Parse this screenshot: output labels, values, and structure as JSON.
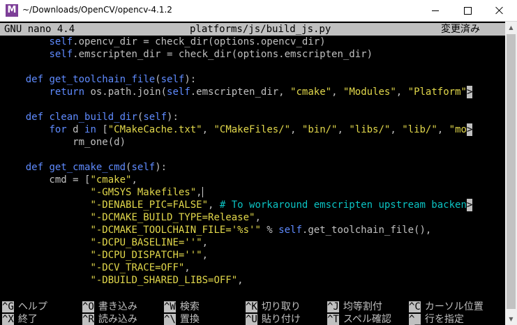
{
  "window": {
    "title": "~/Downloads/OpenCV/opencv-4.1.2",
    "app_icon_letter": "M"
  },
  "nano": {
    "version": "GNU nano 4.4",
    "filename": "platforms/js/build_js.py",
    "status": "変更済み"
  },
  "code_lines": [
    [
      {
        "c": "",
        "t": "        "
      },
      {
        "c": "t-slf",
        "t": "self"
      },
      {
        "c": "",
        "t": ".opencv_dir = check_dir(options.opencv_dir)"
      }
    ],
    [
      {
        "c": "",
        "t": "        "
      },
      {
        "c": "t-slf",
        "t": "self"
      },
      {
        "c": "",
        "t": ".emscripten_dir = check_dir(options.emscripten_dir)"
      }
    ],
    [],
    [
      {
        "c": "",
        "t": "    "
      },
      {
        "c": "t-kw",
        "t": "def"
      },
      {
        "c": "",
        "t": " "
      },
      {
        "c": "t-fn",
        "t": "get_toolchain_file"
      },
      {
        "c": "",
        "t": "("
      },
      {
        "c": "t-slf",
        "t": "self"
      },
      {
        "c": "",
        "t": "):"
      }
    ],
    [
      {
        "c": "",
        "t": "        "
      },
      {
        "c": "t-kw",
        "t": "return"
      },
      {
        "c": "",
        "t": " os.path.join("
      },
      {
        "c": "t-slf",
        "t": "self"
      },
      {
        "c": "",
        "t": ".emscripten_dir, "
      },
      {
        "c": "t-str",
        "t": "\"cmake\""
      },
      {
        "c": "",
        "t": ", "
      },
      {
        "c": "t-str",
        "t": "\"Modules\""
      },
      {
        "c": "",
        "t": ", "
      },
      {
        "c": "t-str",
        "t": "\"Platform\""
      },
      {
        "c": "cont",
        "t": ">"
      }
    ],
    [],
    [
      {
        "c": "",
        "t": "    "
      },
      {
        "c": "t-kw",
        "t": "def"
      },
      {
        "c": "",
        "t": " "
      },
      {
        "c": "t-fn",
        "t": "clean_build_dir"
      },
      {
        "c": "",
        "t": "("
      },
      {
        "c": "t-slf",
        "t": "self"
      },
      {
        "c": "",
        "t": "):"
      }
    ],
    [
      {
        "c": "",
        "t": "        "
      },
      {
        "c": "t-kw",
        "t": "for"
      },
      {
        "c": "",
        "t": " d "
      },
      {
        "c": "t-kw",
        "t": "in"
      },
      {
        "c": "",
        "t": " ["
      },
      {
        "c": "t-str",
        "t": "\"CMakeCache.txt\""
      },
      {
        "c": "",
        "t": ", "
      },
      {
        "c": "t-str",
        "t": "\"CMakeFiles/\""
      },
      {
        "c": "",
        "t": ", "
      },
      {
        "c": "t-str",
        "t": "\"bin/\""
      },
      {
        "c": "",
        "t": ", "
      },
      {
        "c": "t-str",
        "t": "\"libs/\""
      },
      {
        "c": "",
        "t": ", "
      },
      {
        "c": "t-str",
        "t": "\"lib/\""
      },
      {
        "c": "",
        "t": ", "
      },
      {
        "c": "t-str",
        "t": "\"mo"
      },
      {
        "c": "cont",
        "t": ">"
      }
    ],
    [
      {
        "c": "",
        "t": "            rm_one(d)"
      }
    ],
    [],
    [
      {
        "c": "",
        "t": "    "
      },
      {
        "c": "t-kw",
        "t": "def"
      },
      {
        "c": "",
        "t": " "
      },
      {
        "c": "t-fn",
        "t": "get_cmake_cmd"
      },
      {
        "c": "",
        "t": "("
      },
      {
        "c": "t-slf",
        "t": "self"
      },
      {
        "c": "",
        "t": "):"
      }
    ],
    [
      {
        "c": "",
        "t": "        cmd = ["
      },
      {
        "c": "t-str",
        "t": "\"cmake\""
      },
      {
        "c": "",
        "t": ","
      }
    ],
    [
      {
        "c": "",
        "t": "               "
      },
      {
        "c": "t-str",
        "t": "\"-GMSYS Makefiles\""
      },
      {
        "c": "",
        "t": ","
      },
      {
        "c": "cursor",
        "t": ""
      }
    ],
    [
      {
        "c": "",
        "t": "               "
      },
      {
        "c": "t-str",
        "t": "\"-DENABLE_PIC=FALSE\""
      },
      {
        "c": "",
        "t": ", "
      },
      {
        "c": "t-cmt",
        "t": "# To workaround emscripten upstream backen"
      },
      {
        "c": "cont",
        "t": ">"
      }
    ],
    [
      {
        "c": "",
        "t": "               "
      },
      {
        "c": "t-str",
        "t": "\"-DCMAKE_BUILD_TYPE=Release\""
      },
      {
        "c": "",
        "t": ","
      }
    ],
    [
      {
        "c": "",
        "t": "               "
      },
      {
        "c": "t-str",
        "t": "\"-DCMAKE_TOOLCHAIN_FILE='%s'\""
      },
      {
        "c": "",
        "t": " % "
      },
      {
        "c": "t-slf",
        "t": "self"
      },
      {
        "c": "",
        "t": ".get_toolchain_file(),"
      }
    ],
    [
      {
        "c": "",
        "t": "               "
      },
      {
        "c": "t-str",
        "t": "\"-DCPU_BASELINE=''\""
      },
      {
        "c": "",
        "t": ","
      }
    ],
    [
      {
        "c": "",
        "t": "               "
      },
      {
        "c": "t-str",
        "t": "\"-DCPU_DISPATCH=''\""
      },
      {
        "c": "",
        "t": ","
      }
    ],
    [
      {
        "c": "",
        "t": "               "
      },
      {
        "c": "t-str",
        "t": "\"-DCV_TRACE=OFF\""
      },
      {
        "c": "",
        "t": ","
      }
    ],
    [
      {
        "c": "",
        "t": "               "
      },
      {
        "c": "t-str",
        "t": "\"-DBUILD_SHARED_LIBS=OFF\""
      },
      {
        "c": "",
        "t": ","
      }
    ],
    []
  ],
  "shortcuts": [
    [
      {
        "key": "^G",
        "label": "ヘルプ"
      },
      {
        "key": "^O",
        "label": "書き込み"
      },
      {
        "key": "^W",
        "label": "検索"
      },
      {
        "key": "^K",
        "label": "切り取り"
      },
      {
        "key": "^J",
        "label": "均等割付"
      },
      {
        "key": "^C",
        "label": "カーソル位置"
      }
    ],
    [
      {
        "key": "^X",
        "label": "終了"
      },
      {
        "key": "^R",
        "label": "読み込み"
      },
      {
        "key": "^\\",
        "label": "置換"
      },
      {
        "key": "^U",
        "label": "貼り付け"
      },
      {
        "key": "^T",
        "label": "スペル確認"
      },
      {
        "key": "^_",
        "label": "行を指定"
      }
    ]
  ],
  "colors": {
    "keyword": "#5f8bff",
    "string": "#e2d84b",
    "comment": "#0bc3c3",
    "text": "#c0c0c0",
    "background": "#000000"
  }
}
